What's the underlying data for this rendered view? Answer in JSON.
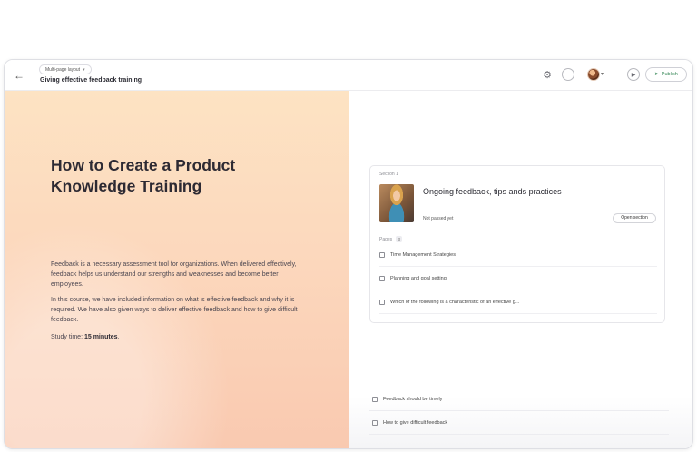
{
  "header": {
    "layout_label": "Multi-page layout",
    "course_title": "Giving effective feedback training",
    "publish_label": "Publish"
  },
  "hero": {
    "title": "How to Create a Product Knowledge Training",
    "paragraph1": "Feedback is a necessary assessment tool for organizations. When delivered effectively, feedback helps us understand our strengths and weaknesses and become better employees.",
    "paragraph2": "In this course, we have included information on what is effective feedback and why it is required. We have also given ways to deliver effective feedback and how to give difficult feedback.",
    "study_label": "Study time:",
    "study_value": "15 minutes",
    "study_suffix": "."
  },
  "section": {
    "label": "Section 1",
    "title": "Ongoing feedback, tips ands practices",
    "status": "Not passed yet",
    "open_label": "Open section",
    "pages_label": "Pages",
    "pages_count": "3",
    "pages": [
      {
        "label": "Time Management Strategies"
      },
      {
        "label": "Planning and goal setting"
      },
      {
        "label": "Which of the following is a characteristic of an effective g..."
      }
    ]
  },
  "outer_pages": [
    {
      "label": "Feedback should be timely"
    },
    {
      "label": "How to give difficult feedback"
    }
  ],
  "icons": {
    "back": "arrow-left-icon",
    "settings": "gear-icon",
    "comment": "comment-icon",
    "play": "play-icon",
    "publish": "rocket-icon"
  },
  "colors": {
    "hero_bg_top": "#fde3c3",
    "hero_bg_bottom": "#f9c9b0",
    "publish_text": "#3a8a5a"
  }
}
